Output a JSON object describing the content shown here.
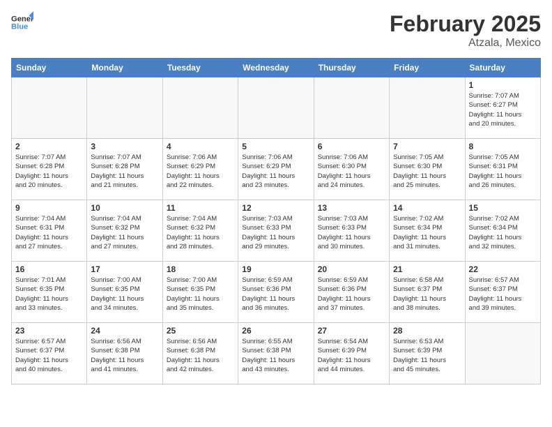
{
  "header": {
    "logo_line1": "General",
    "logo_line2": "Blue",
    "month_title": "February 2025",
    "location": "Atzala, Mexico"
  },
  "weekdays": [
    "Sunday",
    "Monday",
    "Tuesday",
    "Wednesday",
    "Thursday",
    "Friday",
    "Saturday"
  ],
  "weeks": [
    [
      {
        "day": "",
        "info": ""
      },
      {
        "day": "",
        "info": ""
      },
      {
        "day": "",
        "info": ""
      },
      {
        "day": "",
        "info": ""
      },
      {
        "day": "",
        "info": ""
      },
      {
        "day": "",
        "info": ""
      },
      {
        "day": "1",
        "info": "Sunrise: 7:07 AM\nSunset: 6:27 PM\nDaylight: 11 hours\nand 20 minutes."
      }
    ],
    [
      {
        "day": "2",
        "info": "Sunrise: 7:07 AM\nSunset: 6:28 PM\nDaylight: 11 hours\nand 20 minutes."
      },
      {
        "day": "3",
        "info": "Sunrise: 7:07 AM\nSunset: 6:28 PM\nDaylight: 11 hours\nand 21 minutes."
      },
      {
        "day": "4",
        "info": "Sunrise: 7:06 AM\nSunset: 6:29 PM\nDaylight: 11 hours\nand 22 minutes."
      },
      {
        "day": "5",
        "info": "Sunrise: 7:06 AM\nSunset: 6:29 PM\nDaylight: 11 hours\nand 23 minutes."
      },
      {
        "day": "6",
        "info": "Sunrise: 7:06 AM\nSunset: 6:30 PM\nDaylight: 11 hours\nand 24 minutes."
      },
      {
        "day": "7",
        "info": "Sunrise: 7:05 AM\nSunset: 6:30 PM\nDaylight: 11 hours\nand 25 minutes."
      },
      {
        "day": "8",
        "info": "Sunrise: 7:05 AM\nSunset: 6:31 PM\nDaylight: 11 hours\nand 26 minutes."
      }
    ],
    [
      {
        "day": "9",
        "info": "Sunrise: 7:04 AM\nSunset: 6:31 PM\nDaylight: 11 hours\nand 27 minutes."
      },
      {
        "day": "10",
        "info": "Sunrise: 7:04 AM\nSunset: 6:32 PM\nDaylight: 11 hours\nand 27 minutes."
      },
      {
        "day": "11",
        "info": "Sunrise: 7:04 AM\nSunset: 6:32 PM\nDaylight: 11 hours\nand 28 minutes."
      },
      {
        "day": "12",
        "info": "Sunrise: 7:03 AM\nSunset: 6:33 PM\nDaylight: 11 hours\nand 29 minutes."
      },
      {
        "day": "13",
        "info": "Sunrise: 7:03 AM\nSunset: 6:33 PM\nDaylight: 11 hours\nand 30 minutes."
      },
      {
        "day": "14",
        "info": "Sunrise: 7:02 AM\nSunset: 6:34 PM\nDaylight: 11 hours\nand 31 minutes."
      },
      {
        "day": "15",
        "info": "Sunrise: 7:02 AM\nSunset: 6:34 PM\nDaylight: 11 hours\nand 32 minutes."
      }
    ],
    [
      {
        "day": "16",
        "info": "Sunrise: 7:01 AM\nSunset: 6:35 PM\nDaylight: 11 hours\nand 33 minutes."
      },
      {
        "day": "17",
        "info": "Sunrise: 7:00 AM\nSunset: 6:35 PM\nDaylight: 11 hours\nand 34 minutes."
      },
      {
        "day": "18",
        "info": "Sunrise: 7:00 AM\nSunset: 6:35 PM\nDaylight: 11 hours\nand 35 minutes."
      },
      {
        "day": "19",
        "info": "Sunrise: 6:59 AM\nSunset: 6:36 PM\nDaylight: 11 hours\nand 36 minutes."
      },
      {
        "day": "20",
        "info": "Sunrise: 6:59 AM\nSunset: 6:36 PM\nDaylight: 11 hours\nand 37 minutes."
      },
      {
        "day": "21",
        "info": "Sunrise: 6:58 AM\nSunset: 6:37 PM\nDaylight: 11 hours\nand 38 minutes."
      },
      {
        "day": "22",
        "info": "Sunrise: 6:57 AM\nSunset: 6:37 PM\nDaylight: 11 hours\nand 39 minutes."
      }
    ],
    [
      {
        "day": "23",
        "info": "Sunrise: 6:57 AM\nSunset: 6:37 PM\nDaylight: 11 hours\nand 40 minutes."
      },
      {
        "day": "24",
        "info": "Sunrise: 6:56 AM\nSunset: 6:38 PM\nDaylight: 11 hours\nand 41 minutes."
      },
      {
        "day": "25",
        "info": "Sunrise: 6:56 AM\nSunset: 6:38 PM\nDaylight: 11 hours\nand 42 minutes."
      },
      {
        "day": "26",
        "info": "Sunrise: 6:55 AM\nSunset: 6:38 PM\nDaylight: 11 hours\nand 43 minutes."
      },
      {
        "day": "27",
        "info": "Sunrise: 6:54 AM\nSunset: 6:39 PM\nDaylight: 11 hours\nand 44 minutes."
      },
      {
        "day": "28",
        "info": "Sunrise: 6:53 AM\nSunset: 6:39 PM\nDaylight: 11 hours\nand 45 minutes."
      },
      {
        "day": "",
        "info": ""
      }
    ]
  ]
}
